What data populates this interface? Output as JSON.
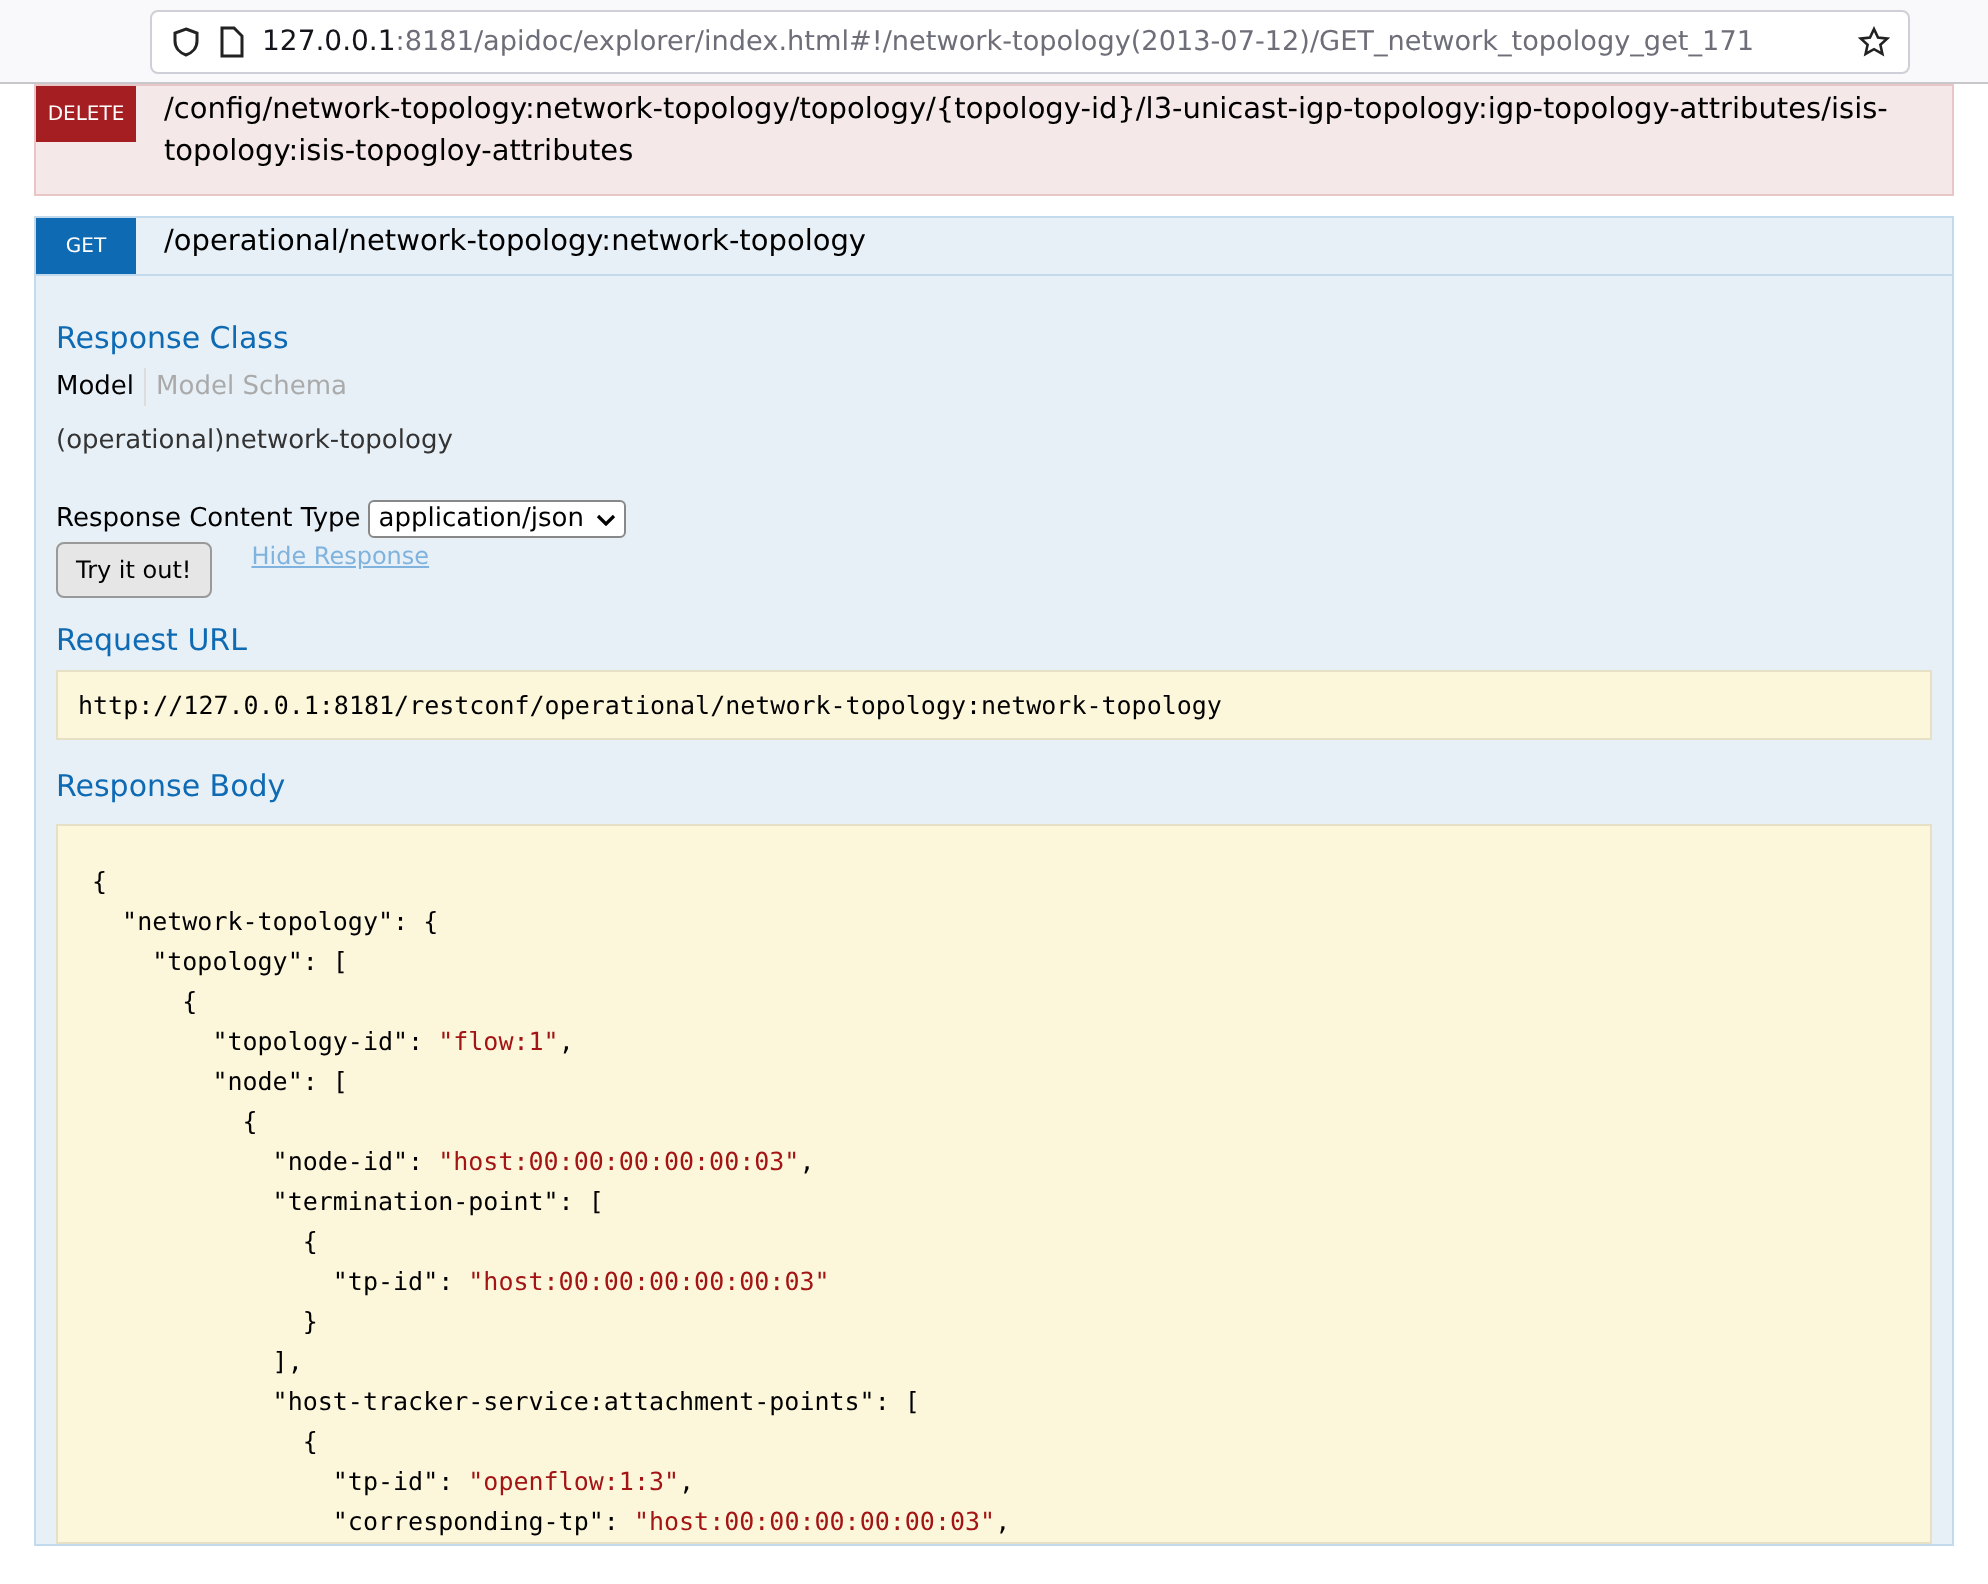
{
  "address_bar": {
    "host": "127.0.0.1",
    "path": ":8181/apidoc/explorer/index.html#!/network-topology(2013-07-12)/GET_network_topology_get_171"
  },
  "operations": [
    {
      "method": "DELETE",
      "path": "/config/network-topology:network-topology/topology/{topology-id}/l3-unicast-igp-topology:igp-topology-attributes/isis-topology:isis-topogloy-attributes",
      "expanded": false
    },
    {
      "method": "GET",
      "path": "/operational/network-topology:network-topology",
      "expanded": true
    }
  ],
  "response_class": {
    "heading": "Response Class",
    "tabs": [
      {
        "label": "Model",
        "selected": true
      },
      {
        "label": "Model Schema",
        "selected": false
      }
    ],
    "model": "(operational)network-topology"
  },
  "content_type": {
    "label": "Response Content Type",
    "value": "application/json"
  },
  "try_button": "Try it out!",
  "hide_link": "Hide Response",
  "request_url": {
    "heading": "Request URL",
    "value": "http://127.0.0.1:8181/restconf/operational/network-topology:network-topology"
  },
  "response_body": {
    "heading": "Response Body",
    "lines": [
      {
        "text": "{"
      },
      {
        "text": "  \"network-topology\": {"
      },
      {
        "text": "    \"topology\": ["
      },
      {
        "text": "      {"
      },
      {
        "text": "        \"topology-id\": ",
        "string": "\"flow:1\"",
        "after": ","
      },
      {
        "text": "        \"node\": ["
      },
      {
        "text": "          {"
      },
      {
        "text": "            \"node-id\": ",
        "string": "\"host:00:00:00:00:00:03\"",
        "after": ","
      },
      {
        "text": "            \"termination-point\": ["
      },
      {
        "text": "              {"
      },
      {
        "text": "                \"tp-id\": ",
        "string": "\"host:00:00:00:00:00:03\""
      },
      {
        "text": "              }"
      },
      {
        "text": "            ],"
      },
      {
        "text": "            \"host-tracker-service:attachment-points\": ["
      },
      {
        "text": "              {"
      },
      {
        "text": "                \"tp-id\": ",
        "string": "\"openflow:1:3\"",
        "after": ","
      },
      {
        "text": "                \"corresponding-tp\": ",
        "string": "\"host:00:00:00:00:00:03\"",
        "after": ","
      }
    ]
  }
}
